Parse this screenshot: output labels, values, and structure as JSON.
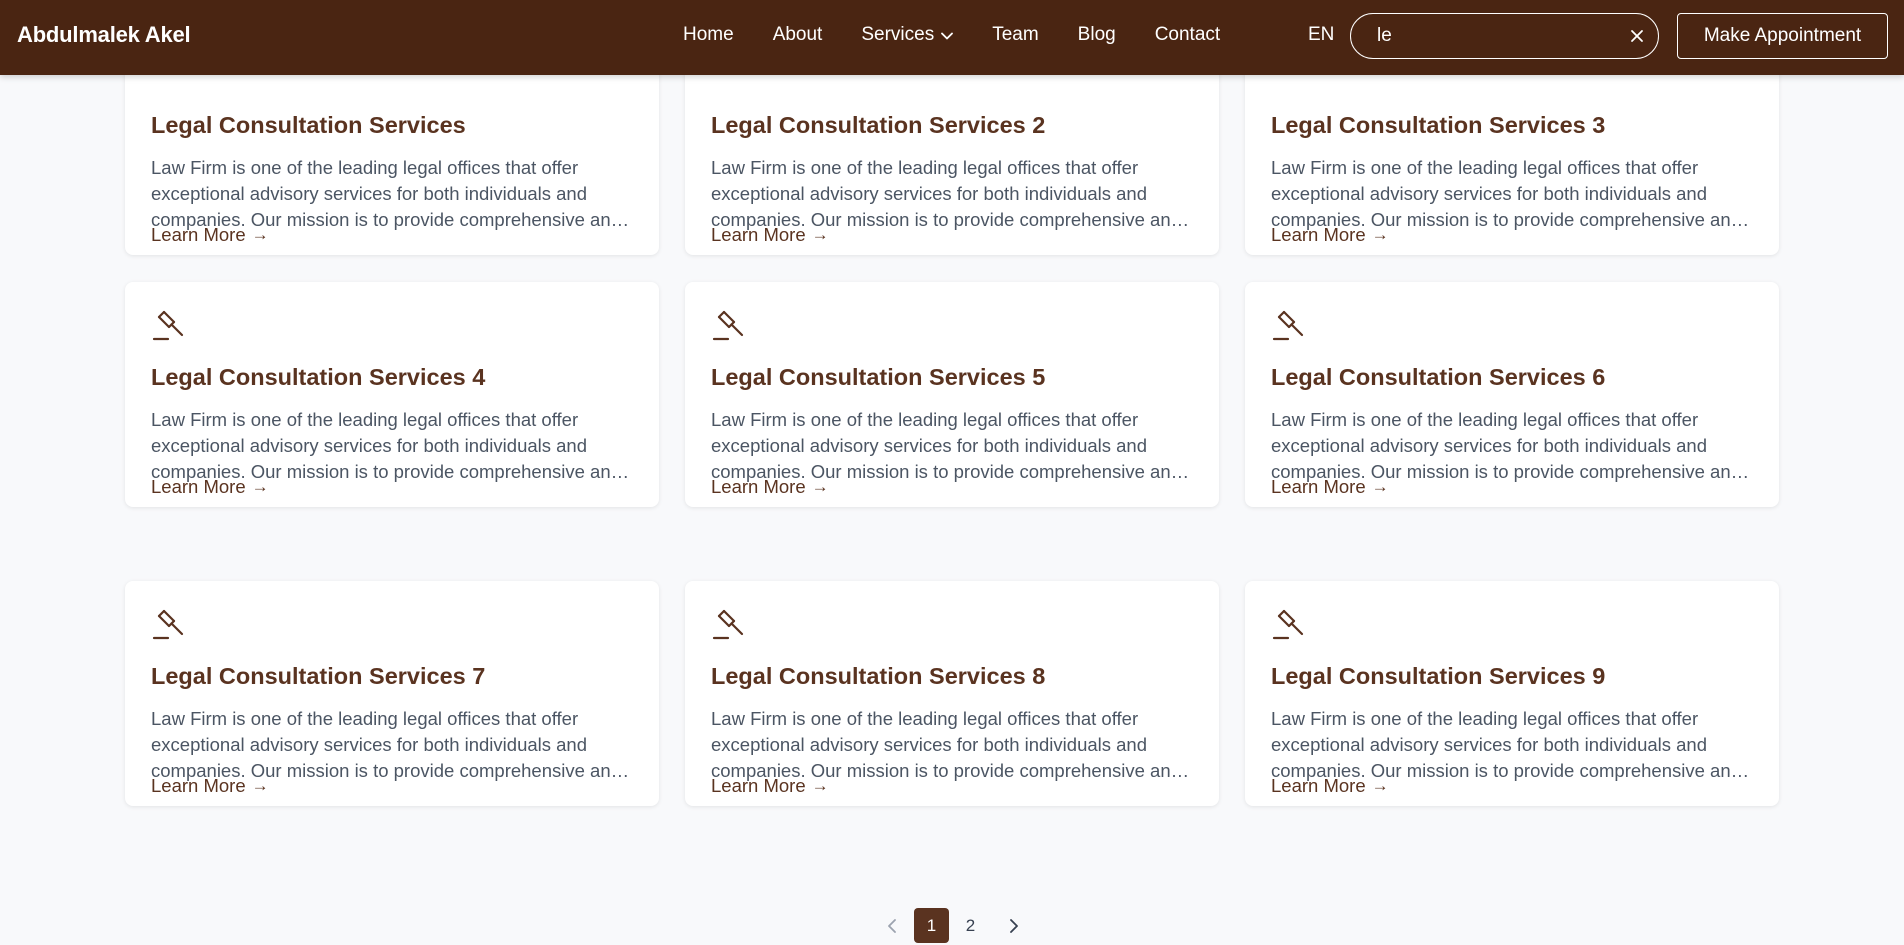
{
  "header": {
    "brand": "Abdulmalek Akel",
    "nav": [
      "Home",
      "About",
      "Services",
      "Team",
      "Blog",
      "Contact"
    ],
    "lang": "EN",
    "search": {
      "value": "le",
      "placeholder": ""
    },
    "appointment_label": "Make Appointment"
  },
  "cards": [
    {
      "title": "Legal Consultation Services",
      "desc": "Law Firm is one of the leading legal offices that offer exceptional advisory services for both individuals and companies. Our mission is to provide comprehensive and tailored legal solutions.",
      "more": "Learn More"
    },
    {
      "title": "Legal Consultation Services 2",
      "desc": "Law Firm is one of the leading legal offices that offer exceptional advisory services for both individuals and companies. Our mission is to provide comprehensive and tailored legal solutions.",
      "more": "Learn More"
    },
    {
      "title": "Legal Consultation Services 3",
      "desc": "Law Firm is one of the leading legal offices that offer exceptional advisory services for both individuals and companies. Our mission is to provide comprehensive and tailored legal solutions.",
      "more": "Learn More"
    },
    {
      "title": "Legal Consultation Services 4",
      "desc": "Law Firm is one of the leading legal offices that offer exceptional advisory services for both individuals and companies. Our mission is to provide comprehensive and tailored legal solutions.",
      "more": "Learn More"
    },
    {
      "title": "Legal Consultation Services 5",
      "desc": "Law Firm is one of the leading legal offices that offer exceptional advisory services for both individuals and companies. Our mission is to provide comprehensive and tailored legal solutions.",
      "more": "Learn More"
    },
    {
      "title": "Legal Consultation Services 6",
      "desc": "Law Firm is one of the leading legal offices that offer exceptional advisory services for both individuals and companies. Our mission is to provide comprehensive and tailored legal solutions.",
      "more": "Learn More"
    },
    {
      "title": "Legal Consultation Services 7",
      "desc": "Law Firm is one of the leading legal offices that offer exceptional advisory services for both individuals and companies. Our mission is to provide comprehensive and tailored legal solutions.",
      "more": "Learn More"
    },
    {
      "title": "Legal Consultation Services 8",
      "desc": "Law Firm is one of the leading legal offices that offer exceptional advisory services for both individuals and companies. Our mission is to provide comprehensive and tailored legal solutions.",
      "more": "Learn More"
    },
    {
      "title": "Legal Consultation Services 9",
      "desc": "Law Firm is one of the leading legal offices that offer exceptional advisory services for both individuals and companies. Our mission is to provide comprehensive and tailored legal solutions.",
      "more": "Learn More"
    }
  ],
  "pagination": {
    "pages": [
      "1",
      "2"
    ],
    "current": "1"
  },
  "colors": {
    "header_bg": "#4a2512",
    "accent": "#5a3320",
    "page_bg": "#f8f9fb"
  }
}
